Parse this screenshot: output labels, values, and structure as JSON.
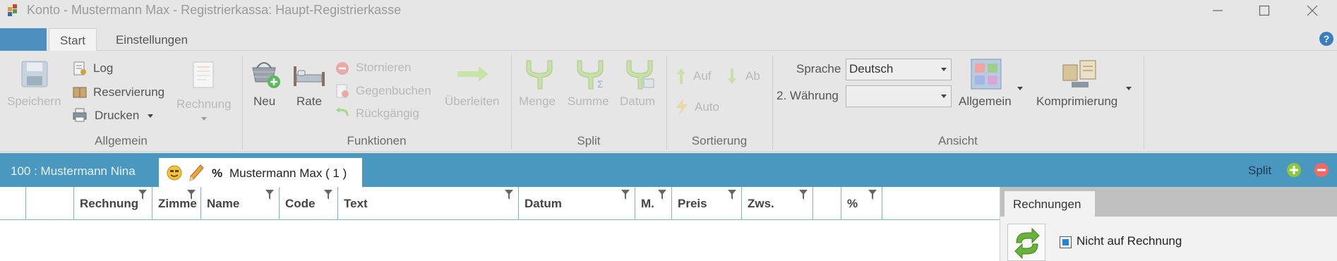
{
  "window": {
    "title": "Konto - Mustermann Max - Registrierkassa: Haupt-Registrierkasse",
    "icon": "app-icon",
    "controls": [
      "minimize-icon",
      "maximize-icon",
      "close-icon"
    ]
  },
  "ribbon_tabs": {
    "start": "Start",
    "einstellungen": "Einstellungen"
  },
  "groups": {
    "allgemein": {
      "label": "Allgemein",
      "speichern": "Speichern",
      "log": "Log",
      "reservierung": "Reservierung",
      "drucken": "Drucken",
      "rechnung": "Rechnung"
    },
    "funktionen": {
      "label": "Funktionen",
      "neu": "Neu",
      "rate": "Rate",
      "stornieren": "Stornieren",
      "gegenbuchen": "Gegenbuchen",
      "rueckgaengig": "Rückgängig",
      "ueberleiten": "Überleiten"
    },
    "split": {
      "label": "Split",
      "menge": "Menge",
      "summe": "Summe",
      "datum": "Datum"
    },
    "sortierung": {
      "label": "Sortierung",
      "auf": "Auf",
      "ab": "Ab",
      "auto": "Auto"
    },
    "ansicht": {
      "label": "Ansicht",
      "sprache_label": "Sprache",
      "sprache_value": "Deutsch",
      "waehrung_label": "2. Währung",
      "waehrung_value": "",
      "allgemein": "Allgemein",
      "komprimierung": "Komprimierung"
    }
  },
  "accounts": {
    "first": "100 :  Mustermann Nina",
    "second_symbol": "%",
    "second": "Mustermann Max ( 1 )",
    "split_label": "Split"
  },
  "grid": {
    "columns": [
      "",
      "",
      "Rechnung",
      "Zimmer",
      "Name",
      "Code",
      "Text",
      "Datum",
      "M.",
      "Preis",
      "Zws.",
      "",
      "%",
      ""
    ]
  },
  "right_panel": {
    "tab": "Rechnungen",
    "checkbox_label": "Nicht auf Rechnung",
    "checkbox_checked": true
  },
  "colors": {
    "accent": "#4a97c0",
    "ribbon_bg": "#e6e6e6",
    "grid_line": "#7fb3d5"
  }
}
